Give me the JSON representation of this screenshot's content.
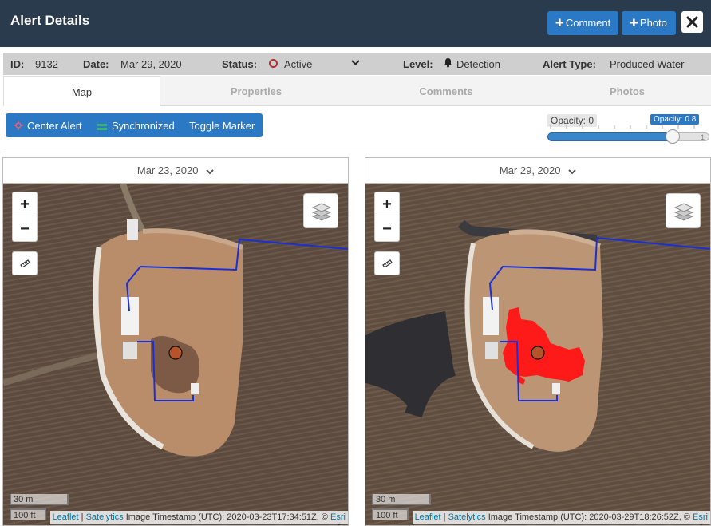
{
  "header": {
    "title": "Alert Details",
    "comment_button": "Comment",
    "photo_button": "Photo"
  },
  "info": {
    "id_label": "ID:",
    "id_value": "9132",
    "date_label": "Date:",
    "date_value": "Mar 29, 2020",
    "status_label": "Status:",
    "status_value": "Active",
    "level_label": "Level:",
    "level_value": "Detection",
    "type_label": "Alert Type:",
    "type_value": "Produced Water"
  },
  "tabs": [
    "Map",
    "Properties",
    "Comments",
    "Photos"
  ],
  "toolbar": {
    "center_alert": "Center Alert",
    "synchronized": "Synchronized",
    "toggle_marker": "Toggle Marker"
  },
  "opacity": {
    "min_label": "Opacity: 0",
    "value_label": "Opacity: 0.8",
    "value": 0.8,
    "max_label": "1"
  },
  "maps": {
    "left": {
      "date": "Mar 23, 2020",
      "scale_m": "30 m",
      "scale_ft": "100 ft",
      "attr_leaflet": "Leaflet",
      "attr_sep": " | ",
      "attr_satelytics": "Satelytics",
      "attr_timestamp": " Image Timestamp (UTC): 2020-03-23T17:34:51Z, © ",
      "attr_esri": "Esri"
    },
    "right": {
      "date": "Mar 29, 2020",
      "scale_m": "30 m",
      "scale_ft": "100 ft",
      "attr_leaflet": "Leaflet",
      "attr_sep": " | ",
      "attr_satelytics": "Satelytics",
      "attr_timestamp": " Image Timestamp (UTC): 2020-03-29T18:26:52Z, © ",
      "attr_esri": "Esri"
    }
  },
  "map_controls": {
    "zoom_in": "+",
    "zoom_out": "−"
  },
  "colors": {
    "header_bg": "#2a3b4d",
    "accent": "#2b78c5",
    "status_active": "#b03030",
    "detection": "#ff0000",
    "pipeline": "#1a2fd6",
    "marker": "#b5532a"
  },
  "icons": [
    "plus-icon",
    "close-icon",
    "status-circle-icon",
    "chevron-down-icon",
    "bell-icon",
    "crosshair-icon",
    "sync-icon",
    "ruler-icon",
    "layers-icon"
  ]
}
